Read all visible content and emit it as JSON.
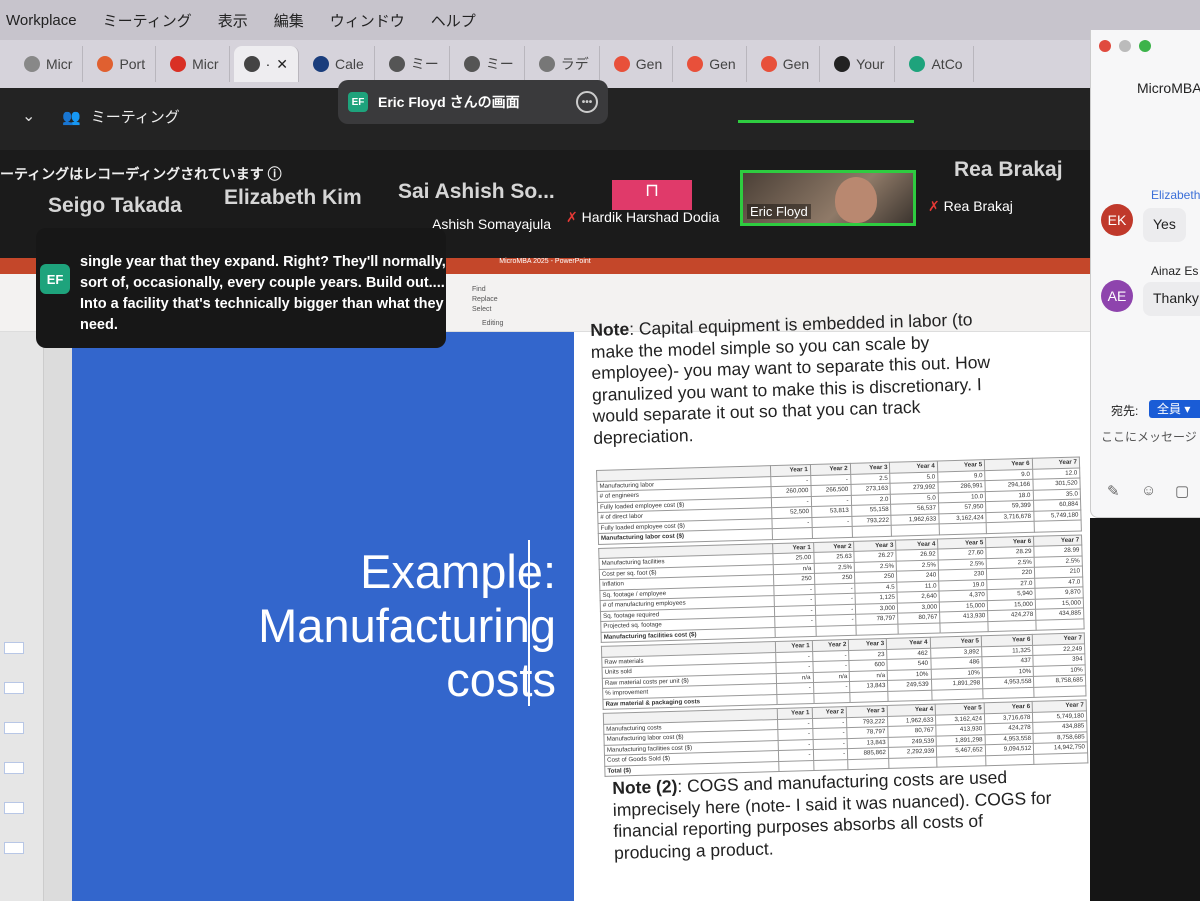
{
  "menubar": {
    "app": "Workplace",
    "items": [
      "ミーティング",
      "表示",
      "編集",
      "ウィンドウ",
      "ヘルプ"
    ]
  },
  "tabs": [
    {
      "label": "Micr",
      "color": "#888"
    },
    {
      "label": "Port",
      "color": "#e06030"
    },
    {
      "label": "Micr",
      "color": "#d93025"
    },
    {
      "label": "·",
      "color": "#444",
      "active": true
    },
    {
      "label": "Cale",
      "color": "#1a3d7c"
    },
    {
      "label": "ミー",
      "color": "#555"
    },
    {
      "label": "ミー",
      "color": "#555"
    },
    {
      "label": "ラデ",
      "color": "#777"
    },
    {
      "label": "Gen",
      "color": "#e8503a"
    },
    {
      "label": "Gen",
      "color": "#e8503a"
    },
    {
      "label": "Gen",
      "color": "#e8503a"
    },
    {
      "label": "Your",
      "color": "#222"
    },
    {
      "label": "AtCo",
      "color": "#1ea37c"
    }
  ],
  "zoom": {
    "meeting_label": "ミーティング",
    "share_title": "Eric Floyd さんの画面",
    "share_badge": "EF",
    "recording_text": "ーティングはレコーディングされています",
    "gallery_names": [
      "Seigo Takada",
      "Elizabeth Kim",
      "Sai Ashish So...",
      "Rea Brakaj"
    ],
    "video_labels": [
      "Ashish Somayajula",
      "Hardik Harshad Dodia",
      "Eric Floyd",
      "Rea Brakaj"
    ],
    "active_speaker": "Eric Floyd"
  },
  "caption": {
    "badge": "EF",
    "text": "single year that they expand. Right? They'll normally, sort of, occasionally, every couple years. Build out.... Into a facility that's technically bigger than what they need."
  },
  "ppt": {
    "window_title": "MicroMBA 2025 - PowerPoint",
    "ribbon_find": "Find",
    "ribbon_replace": "Replace",
    "ribbon_select": "Select",
    "ribbon_editing": "Editing"
  },
  "slide": {
    "title": "Example: Manufacturing costs",
    "note1_label": "Note",
    "note1_text": ": Capital equipment is embedded in labor (to make the model simple so you can scale by employee)- you may want to separate this out. How granulized you want to make this is discretionary. I would separate it out so that you can track depreciation.",
    "note2_label": "Note (2)",
    "note2_text": ": COGS and manufacturing costs are used imprecisely here (note- I said it was nuanced). COGS for financial reporting purposes absorbs all costs of producing a product.",
    "years": [
      "Year 1",
      "Year 2",
      "Year 3",
      "Year 4",
      "Year 5",
      "Year 6",
      "Year 7"
    ],
    "tables": [
      {
        "rows": [
          {
            "label": "Manufacturing labor",
            "values": [
              "-",
              "-",
              "2.5",
              "5.0",
              "9.0",
              "9.0",
              "12.0"
            ]
          },
          {
            "label": "# of engineers",
            "values": [
              "260,000",
              "266,500",
              "273,163",
              "279,992",
              "286,991",
              "294,166",
              "301,520"
            ]
          },
          {
            "label": "Fully loaded employee cost ($)",
            "values": [
              "-",
              "-",
              "2.0",
              "5.0",
              "10.0",
              "18.0",
              "35.0"
            ]
          },
          {
            "label": "# of direct labor",
            "values": [
              "52,500",
              "53,813",
              "55,158",
              "56,537",
              "57,950",
              "59,399",
              "60,884"
            ]
          },
          {
            "label": "Fully loaded employee cost ($)",
            "values": [
              "-",
              "-",
              "793,222",
              "1,962,633",
              "3,162,424",
              "3,716,678",
              "5,749,180"
            ]
          },
          {
            "label": "Manufacturing labor cost ($)",
            "values": [
              "",
              "",
              "",
              "",
              "",
              "",
              ""
            ],
            "total": true
          }
        ]
      },
      {
        "rows": [
          {
            "label": "Manufacturing facilities",
            "values": [
              "25.00",
              "25.63",
              "26.27",
              "26.92",
              "27.60",
              "28.29",
              "28.99"
            ]
          },
          {
            "label": "Cost per sq. foot ($)",
            "values": [
              "n/a",
              "2.5%",
              "2.5%",
              "2.5%",
              "2.5%",
              "2.5%",
              "2.5%"
            ]
          },
          {
            "label": "Inflation",
            "values": [
              "250",
              "250",
              "250",
              "240",
              "230",
              "220",
              "210"
            ]
          },
          {
            "label": "Sq. footage / employee",
            "values": [
              "-",
              "-",
              "4.5",
              "11.0",
              "19.0",
              "27.0",
              "47.0"
            ]
          },
          {
            "label": "# of manufacturing employees",
            "values": [
              "-",
              "-",
              "1,125",
              "2,640",
              "4,370",
              "5,940",
              "9,870"
            ]
          },
          {
            "label": "Sq. footage required",
            "values": [
              "-",
              "-",
              "3,000",
              "3,000",
              "15,000",
              "15,000",
              "15,000"
            ]
          },
          {
            "label": "Projected sq. footage",
            "values": [
              "-",
              "-",
              "78,797",
              "80,767",
              "413,930",
              "424,278",
              "434,885"
            ]
          },
          {
            "label": "Manufacturing facilities cost ($)",
            "values": [
              "",
              "",
              "",
              "",
              "",
              "",
              ""
            ],
            "total": true
          }
        ]
      },
      {
        "rows": [
          {
            "label": "Raw materials",
            "values": [
              "-",
              "-",
              "23",
              "462",
              "3,892",
              "11,325",
              "22,249"
            ]
          },
          {
            "label": "Units sold",
            "values": [
              "-",
              "-",
              "600",
              "540",
              "486",
              "437",
              "394"
            ]
          },
          {
            "label": "Raw material costs per unit ($)",
            "values": [
              "n/a",
              "n/a",
              "n/a",
              "10%",
              "10%",
              "10%",
              "10%"
            ]
          },
          {
            "label": "% improvement",
            "values": [
              "-",
              "-",
              "13,843",
              "249,539",
              "1,891,298",
              "4,953,558",
              "8,758,685"
            ]
          },
          {
            "label": "Raw material & packaging costs",
            "values": [
              "",
              "",
              "",
              "",
              "",
              "",
              ""
            ],
            "total": true
          }
        ]
      },
      {
        "rows": [
          {
            "label": "Manufacturing costs",
            "values": [
              "-",
              "-",
              "793,222",
              "1,962,633",
              "3,162,424",
              "3,716,678",
              "5,749,180"
            ]
          },
          {
            "label": "Manufacturing labor cost ($)",
            "values": [
              "-",
              "-",
              "78,797",
              "80,767",
              "413,930",
              "424,278",
              "434,885"
            ]
          },
          {
            "label": "Manufacturing facilities cost ($)",
            "values": [
              "-",
              "-",
              "13,843",
              "249,539",
              "1,891,298",
              "4,953,558",
              "8,758,685"
            ]
          },
          {
            "label": "Cost of Goods Sold ($)",
            "values": [
              "-",
              "-",
              "885,862",
              "2,292,939",
              "5,467,652",
              "9,094,512",
              "14,942,750"
            ]
          },
          {
            "label": "Total ($)",
            "values": [
              "",
              "",
              "",
              "",
              "",
              "",
              ""
            ],
            "total": true
          }
        ]
      }
    ]
  },
  "chat": {
    "title": "MicroMBA",
    "messages": [
      {
        "sender": "Elizabeth",
        "initials": "EK",
        "color": "#c0392b",
        "text": "Yes"
      },
      {
        "sender": "Ainaz Es",
        "initials": "AE",
        "color": "#8e44ad",
        "text": "Thanky"
      }
    ],
    "to_label": "宛先:",
    "to_value": "全員",
    "placeholder": "ここにメッセージ"
  },
  "colors": {
    "slide_blue": "#3366cc",
    "ppt_orange": "#c4472a",
    "active_speaker_green": "#2ecc40"
  }
}
